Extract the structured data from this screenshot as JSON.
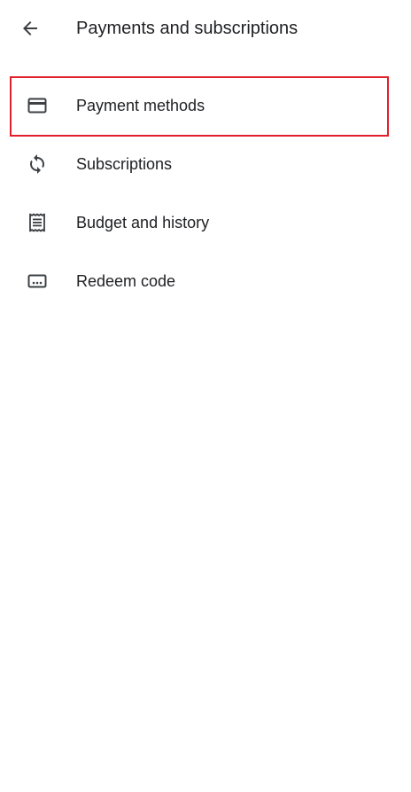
{
  "header": {
    "title": "Payments and subscriptions",
    "back_icon": "arrow-back-icon"
  },
  "menu": {
    "items": [
      {
        "label": "Payment methods",
        "icon": "credit-card-icon"
      },
      {
        "label": "Subscriptions",
        "icon": "sync-icon"
      },
      {
        "label": "Budget and history",
        "icon": "receipt-icon"
      },
      {
        "label": "Redeem code",
        "icon": "redeem-code-icon"
      }
    ]
  },
  "colors": {
    "text": "#202124",
    "icon": "#3c4043",
    "highlight": "#e0202a",
    "background": "#ffffff"
  }
}
